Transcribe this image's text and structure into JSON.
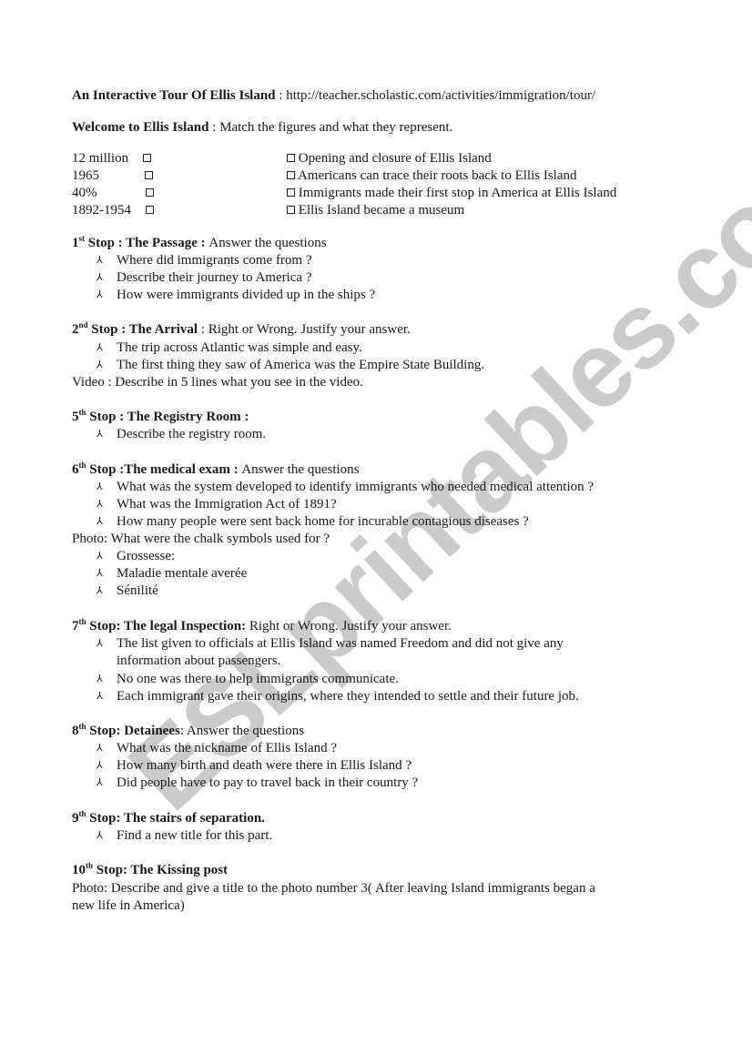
{
  "header": {
    "title": "An Interactive Tour Of Ellis Island",
    "separator": " : ",
    "url": "http://teacher.scholastic.com/activities/immigration/tour/"
  },
  "welcome": {
    "title": "Welcome to Ellis Island",
    "separator": " : ",
    "instruction": "Match the figures and what they represent."
  },
  "match": {
    "figures": [
      "12 million",
      "1965",
      "40%",
      "1892-1954"
    ],
    "meanings": [
      "Opening and closure of Ellis Island",
      " Americans can trace their roots back to Ellis Island",
      "Immigrants made their first stop in America at Ellis Island",
      "Ellis Island became a museum"
    ],
    "box_icon": "checkbox-square"
  },
  "bullet_icon": "arrowhead-up",
  "watermark": "ESLprintables.com",
  "stops": {
    "s1": {
      "num": "1",
      "suffix": "st",
      "title": " Stop : The Passage : ",
      "instruction": "Answer the questions",
      "items": [
        "Where did immigrants come from ?",
        "Describe their journey to America ?",
        "How were immigrants divided up in the ships ?"
      ]
    },
    "s2": {
      "num": "2",
      "suffix": "nd",
      "title": " Stop : The Arrival",
      "instruction": " : Right or Wrong. Justify your answer.",
      "items": [
        "The trip across Atlantic was simple and easy.",
        "The first thing they saw of America was the Empire State Building."
      ],
      "note": "Video : Describe in 5 lines what you see in the video."
    },
    "s5": {
      "num": "5",
      "suffix": "th",
      "title": " Stop : The Registry Room :",
      "instruction": "",
      "items": [
        "Describe the registry room."
      ]
    },
    "s6": {
      "num": "6",
      "suffix": "th",
      "title": " Stop :The medical exam : ",
      "instruction": "Answer the questions",
      "items": [
        "What was the system developed to identify immigrants who needed medical attention ?",
        "What was the Immigration Act of 1891?",
        "How many people were sent back home for incurable contagious diseases ?"
      ],
      "note": "Photo: What were the chalk symbols used for ?",
      "items2": [
        "Grossesse:",
        "Maladie mentale averée",
        "Sénilité"
      ]
    },
    "s7": {
      "num": "7",
      "suffix": "th",
      "title": " Stop: The legal Inspection:",
      "instruction": " Right or Wrong. Justify your answer.",
      "items": [
        "The list given to officials at Ellis Island was named Freedom and did not give any",
        "information about passengers.",
        "No one was there to help immigrants communicate.",
        "Each immigrant gave their origins, where they intended to settle and their future job."
      ]
    },
    "s8": {
      "num": "8",
      "suffix": "th",
      "title": " Stop: Detainees",
      "instruction": ": Answer the questions",
      "items": [
        "What was the nickname of Ellis Island ?",
        "How many birth and death were there in Ellis Island ?",
        "Did people have to pay to travel back in their country ?"
      ]
    },
    "s9": {
      "num": "9",
      "suffix": "th",
      "title": " Stop: The stairs of separation.",
      "instruction": "",
      "items": [
        "Find a new title for this part."
      ]
    },
    "s10": {
      "num": "10",
      "suffix": "th",
      "title": " Stop: The Kissing post",
      "instruction": "",
      "note_lines": [
        "Photo: Describe and give a title to the photo number 3( After leaving Island immigrants began a",
        "new life in America)"
      ]
    }
  }
}
